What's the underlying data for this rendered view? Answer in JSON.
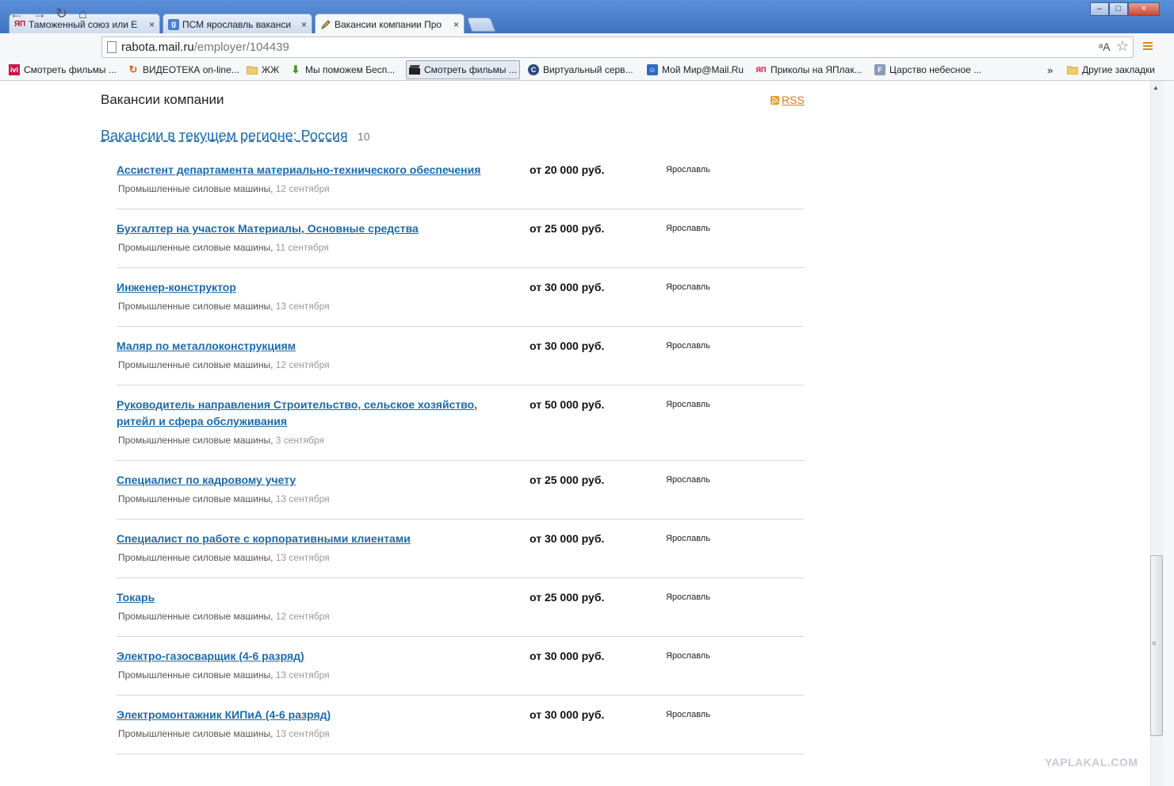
{
  "tabs": [
    {
      "label": "Таможенный союз или Е",
      "favicon": "ЯП"
    },
    {
      "label": "ПСМ ярославль ваканси",
      "favicon": "g"
    },
    {
      "label": "Вакансии компании Про",
      "favicon": "pen"
    }
  ],
  "address": {
    "host": "rabota.mail.ru",
    "path": "/employer/104439"
  },
  "bookmarks": [
    {
      "label": "Смотреть фильмы ...",
      "icon": "ivi"
    },
    {
      "label": "ВИДЕОТЕКА on-line...",
      "icon": "refresh"
    },
    {
      "label": "ЖЖ",
      "icon": "folder"
    },
    {
      "label": "Мы поможем Бесп...",
      "icon": "arrow-down"
    },
    {
      "label": "Смотреть фильмы ...",
      "icon": "clapper"
    },
    {
      "label": "Виртуальный серв...",
      "icon": "c-logo"
    },
    {
      "label": "Мой Мир@Mail.Ru",
      "icon": "face"
    },
    {
      "label": "Приколы на ЯПлак...",
      "icon": "ЯП"
    },
    {
      "label": "Царство небесное ...",
      "icon": "F"
    }
  ],
  "bookmarks_more": "»",
  "other_bookmarks": "Другие закладки",
  "page": {
    "heading": "Вакансии компании",
    "rss": "RSS",
    "region": "Вакансии в текущем регионе: Россия",
    "count": "10"
  },
  "company": "Промышленные силовые машины",
  "vacancies": [
    {
      "title": "Ассистент департамента материально-технического обеспечения",
      "salary": "от 20 000 руб.",
      "city": "Ярославль",
      "date": "12 сентября"
    },
    {
      "title": "Бухгалтер на участок Материалы, Основные средства",
      "salary": "от 25 000 руб.",
      "city": "Ярославль",
      "date": "11 сентября"
    },
    {
      "title": "Инженер-конструктор",
      "salary": "от 30 000 руб.",
      "city": "Ярославль",
      "date": "13 сентября"
    },
    {
      "title": "Маляр по металлоконструкциям",
      "salary": "от 30 000 руб.",
      "city": "Ярославль",
      "date": "12 сентября"
    },
    {
      "title": "Руководитель направления Строительство, сельское хозяйство, ритейл и сфера обслуживания",
      "salary": "от 50 000 руб.",
      "city": "Ярославль",
      "date": "3 сентября"
    },
    {
      "title": "Специалист по кадровому учету",
      "salary": "от 25 000 руб.",
      "city": "Ярославль",
      "date": "13 сентября"
    },
    {
      "title": "Специалист по работе с корпоративными клиентами",
      "salary": "от 30 000 руб.",
      "city": "Ярославль",
      "date": "13 сентября"
    },
    {
      "title": "Токарь",
      "salary": "от 25 000 руб.",
      "city": "Ярославль",
      "date": "12 сентября"
    },
    {
      "title": "Электро-газосварщик (4-6 разряд)",
      "salary": "от 30 000 руб.",
      "city": "Ярославль",
      "date": "13 сентября"
    },
    {
      "title": "Электромонтажник КИПиА (4-6 разряд)",
      "salary": "от 30 000 руб.",
      "city": "Ярославль",
      "date": "13 сентября"
    }
  ],
  "watermark": "YAPLAKAL.COM",
  "colors": {
    "link": "#1e6aa8",
    "rss": "#c9821f",
    "titlebar": "#4a80cf"
  }
}
